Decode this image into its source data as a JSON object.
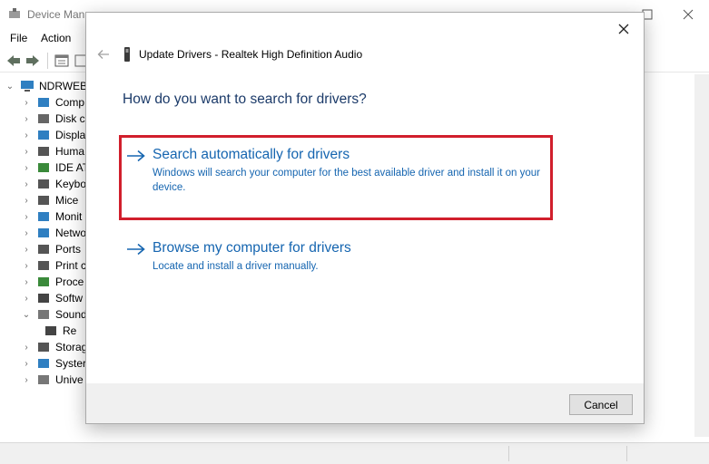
{
  "device_manager": {
    "title": "Device Mana",
    "menu": [
      "File",
      "Action"
    ],
    "root_node": "NDRWEB",
    "tree": [
      {
        "label": "Comp",
        "icon": "computer-icon",
        "expanded": false
      },
      {
        "label": "Disk c",
        "icon": "disk-drive-icon",
        "expanded": false
      },
      {
        "label": "Displa",
        "icon": "display-adapter-icon",
        "expanded": false
      },
      {
        "label": "Huma",
        "icon": "human-interface-icon",
        "expanded": false
      },
      {
        "label": "IDE AT",
        "icon": "ide-controller-icon",
        "expanded": false
      },
      {
        "label": "Keybo",
        "icon": "keyboard-icon",
        "expanded": false
      },
      {
        "label": "Mice",
        "icon": "mouse-icon",
        "expanded": false
      },
      {
        "label": "Monit",
        "icon": "monitor-icon",
        "expanded": false
      },
      {
        "label": "Netwo",
        "icon": "network-adapter-icon",
        "expanded": false
      },
      {
        "label": "Ports",
        "icon": "ports-icon",
        "expanded": false
      },
      {
        "label": "Print c",
        "icon": "print-queue-icon",
        "expanded": false
      },
      {
        "label": "Proce",
        "icon": "processor-icon",
        "expanded": false
      },
      {
        "label": "Softw",
        "icon": "software-device-icon",
        "expanded": false
      },
      {
        "label": "Sound",
        "icon": "sound-icon",
        "expanded": true
      },
      {
        "label": "Re",
        "icon": "audio-device-icon",
        "child": true
      },
      {
        "label": "Storag",
        "icon": "storage-controller-icon",
        "expanded": false
      },
      {
        "label": "Syster",
        "icon": "system-device-icon",
        "expanded": false
      },
      {
        "label": "Unive",
        "icon": "usb-icon",
        "expanded": false
      }
    ]
  },
  "dialog": {
    "title": "Update Drivers - Realtek High Definition Audio",
    "heading": "How do you want to search for drivers?",
    "options": [
      {
        "title": "Search automatically for drivers",
        "description": "Windows will search your computer for the best available driver and install it on your device."
      },
      {
        "title": "Browse my computer for drivers",
        "description": "Locate and install a driver manually."
      }
    ],
    "cancel_label": "Cancel",
    "close_glyph": "✕"
  },
  "colors": {
    "link_blue": "#1565b0",
    "heading_blue": "#1b3a69",
    "highlight_red": "#d11f2c"
  }
}
